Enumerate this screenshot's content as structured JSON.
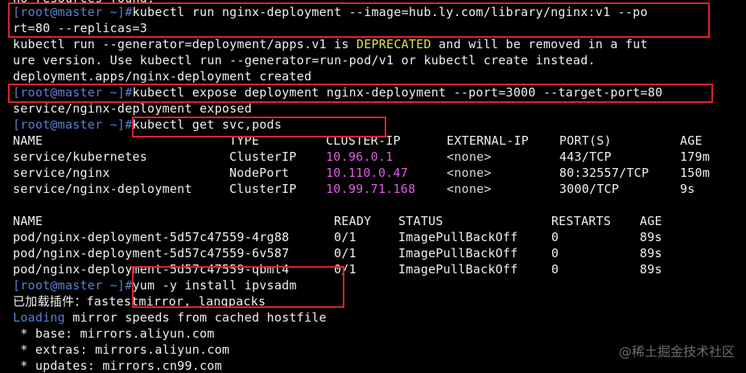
{
  "terminal": {
    "prompt": "[root@master ~]#",
    "lines": {
      "l0": "no resources found.",
      "l1_cmd": "kubectl run nginx-deployment --image=hub.ly.com/library/nginx:v1 --po",
      "l2": "rt=80 --replicas=3",
      "l3_a": "kubectl run --generator=deployment/apps.v1 is ",
      "l3_b": "DEPRECATED",
      "l3_c": " and will be removed in a fut",
      "l4": "ure version. Use kubectl run --generator=run-pod/v1 or kubectl create instead.",
      "l5": "deployment.apps/nginx-deployment created",
      "l6_cmd": "kubectl expose deployment nginx-deployment --port=3000 --target-port=80",
      "l7": "service/nginx-deployment exposed",
      "l8_cmd": "kubectl get svc,pods",
      "l17_cmd": "yum -y install ipvsadm",
      "l18": "已加载插件：fastestmirror, langpacks",
      "l19_a": "Loading",
      "l19_b": " mirror speeds from cached hostfile",
      "l20": " * base: mirrors.aliyun.com",
      "l21": " * extras: mirrors.aliyun.com",
      "l22": " * updates: mirrors.cn99.com"
    },
    "svc_table": {
      "headers": [
        "NAME",
        "TYPE",
        "CLUSTER-IP",
        "EXTERNAL-IP",
        "PORT(S)",
        "AGE"
      ],
      "rows": [
        [
          "service/kubernetes",
          "ClusterIP",
          "10.96.0.1",
          "<none>",
          "443/TCP",
          "179m"
        ],
        [
          "service/nginx",
          "NodePort",
          "10.110.0.47",
          "<none>",
          "80:32557/TCP",
          "150m"
        ],
        [
          "service/nginx-deployment",
          "ClusterIP",
          "10.99.71.168",
          "<none>",
          "3000/TCP",
          "9s"
        ]
      ]
    },
    "pod_table": {
      "headers": [
        "NAME",
        "READY",
        "STATUS",
        "RESTARTS",
        "AGE"
      ],
      "rows": [
        [
          "pod/nginx-deployment-5d57c47559-4rg88",
          "0/1",
          "ImagePullBackOff",
          "0",
          "89s"
        ],
        [
          "pod/nginx-deployment-5d57c47559-6v587",
          "0/1",
          "ImagePullBackOff",
          "0",
          "89s"
        ],
        [
          "pod/nginx-deployment-5d57c47559-qbmt4",
          "0/1",
          "ImagePullBackOff",
          "0",
          "89s"
        ]
      ]
    }
  },
  "watermark": "@稀土掘金技术社区",
  "colors": {
    "background": "#000000",
    "prompt": "#5a7fd6",
    "text": "#f0f0f0",
    "warning": "#e0e04a",
    "ip": "#e25ae6",
    "highlight_box": "#e0242a"
  }
}
